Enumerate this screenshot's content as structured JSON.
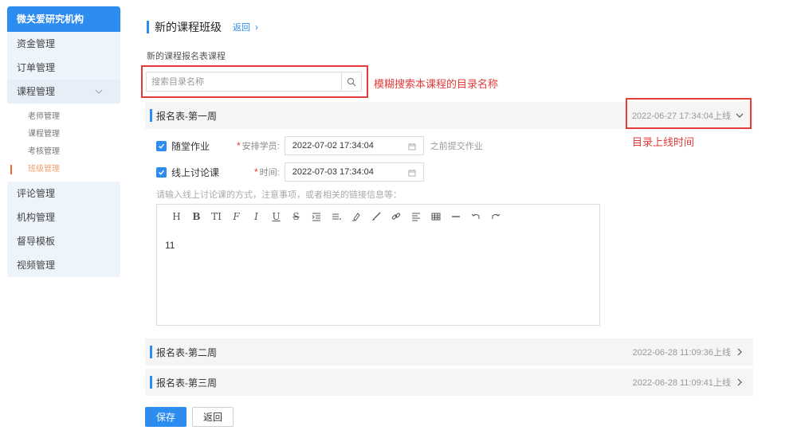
{
  "sidebar": {
    "brand": "微关爱研究机构",
    "items": [
      {
        "label": "资金管理"
      },
      {
        "label": "订单管理"
      },
      {
        "label": "课程管理"
      }
    ],
    "sub_items": [
      {
        "label": "老师管理"
      },
      {
        "label": "课程管理"
      },
      {
        "label": "考核管理"
      },
      {
        "label": "班级管理"
      }
    ],
    "items_after": [
      {
        "label": "评论管理"
      },
      {
        "label": "机构管理"
      },
      {
        "label": "督导模板"
      },
      {
        "label": "视频管理"
      }
    ]
  },
  "header": {
    "title": "新的课程班级",
    "back_link": "返回",
    "subtitle": "新的课程报名表课程"
  },
  "search": {
    "placeholder": "搜索目录名称",
    "value": ""
  },
  "annotations": {
    "search_note": "模糊搜索本课程的目录名称",
    "time_note": "目录上线时间"
  },
  "weeks": [
    {
      "title": "报名表-第一周",
      "time": "2022-06-27 17:34:04上线"
    },
    {
      "title": "报名表-第二周",
      "time": "2022-06-28 11:09:36上线"
    },
    {
      "title": "报名表-第三周",
      "time": "2022-06-28 11:09:41上线"
    }
  ],
  "form": {
    "homework_label": "随堂作业",
    "assign_label": "安排学员:",
    "assign_date": "2022-07-02 17:34:04",
    "assign_after": "之前提交作业",
    "discussion_label": "线上讨论课",
    "time_label": "时间:",
    "time_date": "2022-07-03 17:34:04",
    "hint": "请输入线上讨论课的方式，注意事项，或者相关的链接信息等：",
    "editor_content": "11"
  },
  "toolbar": {
    "heading": "H",
    "bold": "B",
    "font_size": "TI",
    "strike_alt": "F",
    "italic": "I",
    "underline": "U",
    "strikethrough": "S"
  },
  "buttons": {
    "save": "保存",
    "back": "返回"
  },
  "colors": {
    "accent": "#2d8cf0",
    "annotation": "#e43a3a",
    "active_sub": "#f06a2a"
  }
}
